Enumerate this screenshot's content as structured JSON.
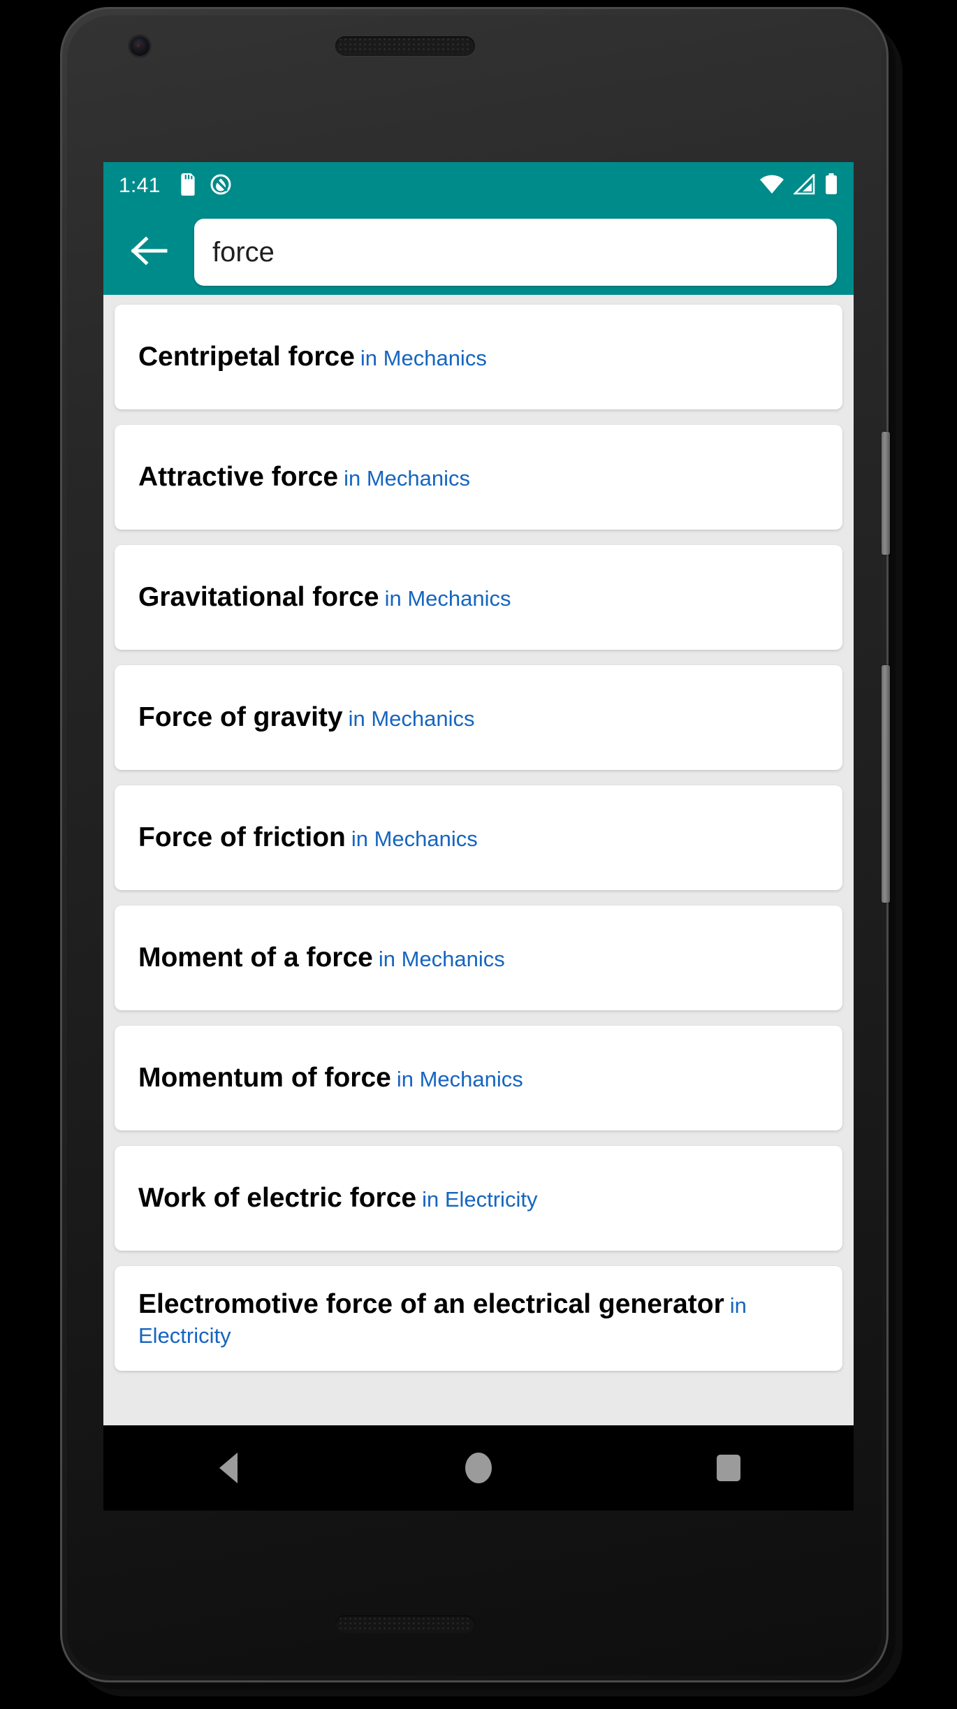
{
  "status_bar": {
    "time": "1:41",
    "left_icons": [
      "sd-card-icon",
      "do-not-disturb-icon"
    ],
    "right_icons": [
      "wifi-icon",
      "cell-signal-icon",
      "battery-icon"
    ],
    "background_color": "#008b8b"
  },
  "app_bar": {
    "back_icon": "back-arrow-icon",
    "search": {
      "value": "force",
      "placeholder": "Search"
    }
  },
  "results": [
    {
      "term": "Centripetal force",
      "category": "in Mechanics"
    },
    {
      "term": "Attractive force",
      "category": "in Mechanics"
    },
    {
      "term": "Gravitational force",
      "category": "in Mechanics"
    },
    {
      "term": "Force of gravity",
      "category": "in Mechanics"
    },
    {
      "term": "Force of friction",
      "category": "in Mechanics"
    },
    {
      "term": "Moment of a force",
      "category": "in Mechanics"
    },
    {
      "term": "Momentum of force",
      "category": "in Mechanics"
    },
    {
      "term": "Work of electric force",
      "category": "in Electricity"
    },
    {
      "term": "Electromotive force of an electrical generator",
      "category": "in Electricity"
    }
  ],
  "nav_bar": {
    "back": "back-triangle-icon",
    "home": "home-circle-icon",
    "recents": "recents-square-icon"
  },
  "colors": {
    "accent_teal": "#008b8b",
    "category_blue": "#1565c0",
    "list_background": "#e9e9e9",
    "card_background": "#ffffff"
  }
}
